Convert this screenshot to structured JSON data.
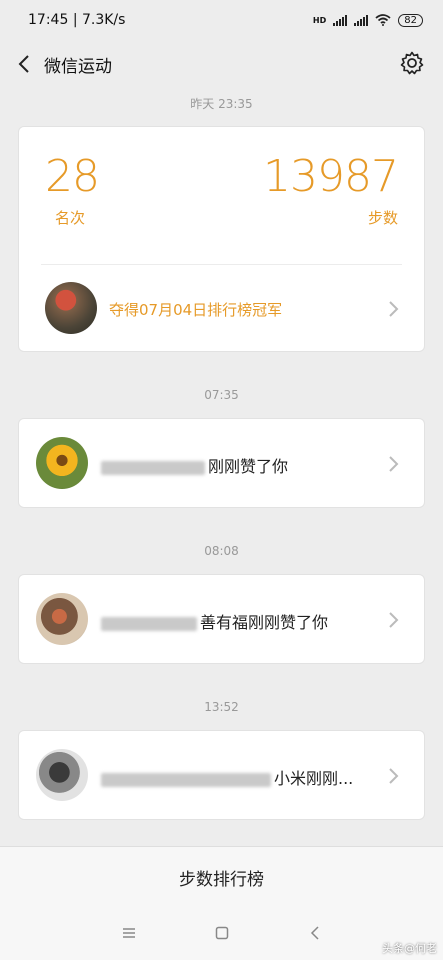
{
  "status": {
    "time": "17:45",
    "speed": "7.3K/s",
    "hd": "HD",
    "battery": "82"
  },
  "appbar": {
    "title": "微信运动"
  },
  "cards": {
    "rank": {
      "time": "昨天 23:35",
      "rank_value": "28",
      "rank_label": "名次",
      "steps_value": "13987",
      "steps_label": "步数",
      "champion_text": "夺得07月04日排行榜冠军"
    },
    "like1": {
      "time": "07:35",
      "text": "刚刚赞了你"
    },
    "like2": {
      "time": "08:08",
      "text": "善有福刚刚赞了你"
    },
    "like3": {
      "time": "13:52",
      "text": "小米刚刚..."
    }
  },
  "bottom": {
    "button_label": "步数排行榜"
  },
  "watermark": "头条@何老"
}
